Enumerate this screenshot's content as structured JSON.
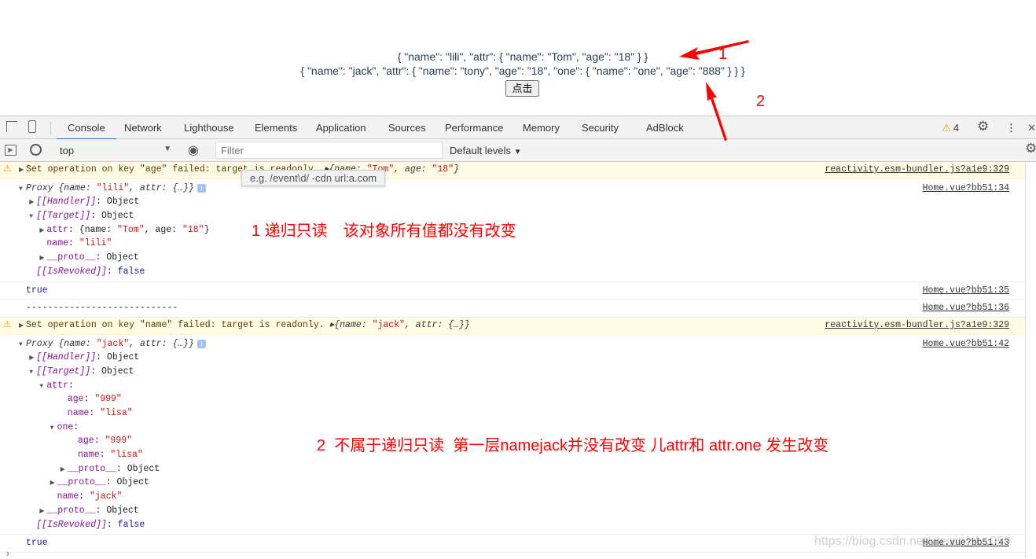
{
  "page": {
    "line1": "{ \"name\": \"lili\", \"attr\": { \"name\": \"Tom\", \"age\": \"18\" } }",
    "line2": "{ \"name\": \"jack\", \"attr\": { \"name\": \"tony\", \"age\": \"18\", \"one\": { \"name\": \"one\", \"age\": \"888\" } } }",
    "button": "点击"
  },
  "devtools": {
    "tabs": [
      "Console",
      "Network",
      "Lighthouse",
      "Elements",
      "Application",
      "Sources",
      "Performance",
      "Memory",
      "Security",
      "AdBlock"
    ],
    "warning_count": "4",
    "context": "top",
    "filter_placeholder": "Filter",
    "levels": "Default levels",
    "filter_tooltip": "e.g. /event\\d/ -cdn url:a.com"
  },
  "console": [
    {
      "type": "warn",
      "src": "reactivity.esm-bundler.js?a1e9:329",
      "lines": [
        [
          0,
          "c",
          [
            [
              "",
              "Set operation on key \"age\" failed: target is readonly. "
            ],
            [
              "it",
              "▸{name: "
            ],
            [
              "s",
              "\"Tom\""
            ],
            [
              "it",
              ", age: "
            ],
            [
              "s",
              "\"18\""
            ],
            [
              "it",
              "}"
            ]
          ]
        ]
      ]
    },
    {
      "type": "log",
      "src": "Home.vue?bb51:34",
      "lines": [
        [
          0,
          "o",
          [
            [
              "it",
              "Proxy {name: "
            ],
            [
              "s",
              "\"lili\""
            ],
            [
              "it",
              ", attr: {…}}"
            ]
          ]
        ],
        [
          1,
          "c",
          [
            [
              "k",
              "[[Handler]]"
            ],
            [
              "",
              ": Object"
            ]
          ]
        ],
        [
          1,
          "o",
          [
            [
              "k",
              "[[Target]]"
            ],
            [
              "",
              ": Object"
            ]
          ]
        ],
        [
          2,
          "c",
          [
            [
              "p",
              "attr"
            ],
            [
              "",
              ": {name: "
            ],
            [
              "s",
              "\"Tom\""
            ],
            [
              "",
              ", age: "
            ],
            [
              "s",
              "\"18\""
            ],
            [
              "",
              "}"
            ]
          ]
        ],
        [
          2,
          "n",
          [
            [
              "p",
              "name"
            ],
            [
              "",
              ": "
            ],
            [
              "s",
              "\"lili\""
            ]
          ]
        ],
        [
          2,
          "c",
          [
            [
              "p",
              "__proto__"
            ],
            [
              "",
              ": Object"
            ]
          ]
        ],
        [
          1,
          "n",
          [
            [
              "k",
              "[[IsRevoked]]"
            ],
            [
              "",
              ": "
            ],
            [
              "b",
              "false"
            ]
          ]
        ]
      ]
    },
    {
      "type": "log",
      "src": "Home.vue?bb51:35",
      "lines": [
        [
          0,
          "n",
          [
            [
              "b",
              "true"
            ]
          ]
        ]
      ]
    },
    {
      "type": "log",
      "src": "Home.vue?bb51:36",
      "lines": [
        [
          0,
          "n",
          [
            [
              "",
              "----------------------------"
            ]
          ]
        ]
      ]
    },
    {
      "type": "warn",
      "src": "reactivity.esm-bundler.js?a1e9:329",
      "lines": [
        [
          0,
          "c",
          [
            [
              "",
              "Set operation on key \"name\" failed: target is readonly. "
            ],
            [
              "it",
              "▸{name: "
            ],
            [
              "s",
              "\"jack\""
            ],
            [
              "it",
              ", attr: {…}}"
            ]
          ]
        ]
      ]
    },
    {
      "type": "log",
      "src": "Home.vue?bb51:42",
      "lines": [
        [
          0,
          "o",
          [
            [
              "it",
              "Proxy {name: "
            ],
            [
              "s",
              "\"jack\""
            ],
            [
              "it",
              ", attr: {…}}"
            ]
          ]
        ],
        [
          1,
          "c",
          [
            [
              "k",
              "[[Handler]]"
            ],
            [
              "",
              ": Object"
            ]
          ]
        ],
        [
          1,
          "o",
          [
            [
              "k",
              "[[Target]]"
            ],
            [
              "",
              ": Object"
            ]
          ]
        ],
        [
          2,
          "o",
          [
            [
              "p",
              "attr"
            ],
            [
              "",
              ":"
            ]
          ]
        ],
        [
          4,
          "n",
          [
            [
              "p",
              "age"
            ],
            [
              "",
              ": "
            ],
            [
              "s",
              "\"999\""
            ]
          ]
        ],
        [
          4,
          "n",
          [
            [
              "p",
              "name"
            ],
            [
              "",
              ": "
            ],
            [
              "s",
              "\"lisa\""
            ]
          ]
        ],
        [
          3,
          "o",
          [
            [
              "p",
              "one"
            ],
            [
              "",
              ":"
            ]
          ]
        ],
        [
          5,
          "n",
          [
            [
              "p",
              "age"
            ],
            [
              "",
              ": "
            ],
            [
              "s",
              "\"999\""
            ]
          ]
        ],
        [
          5,
          "n",
          [
            [
              "p",
              "name"
            ],
            [
              "",
              ": "
            ],
            [
              "s",
              "\"lisa\""
            ]
          ]
        ],
        [
          4,
          "c",
          [
            [
              "p",
              "__proto__"
            ],
            [
              "",
              ": Object"
            ]
          ]
        ],
        [
          3,
          "c",
          [
            [
              "p",
              "__proto__"
            ],
            [
              "",
              ": Object"
            ]
          ]
        ],
        [
          3,
          "n",
          [
            [
              "p",
              "name"
            ],
            [
              "",
              ": "
            ],
            [
              "s",
              "\"jack\""
            ]
          ]
        ],
        [
          2,
          "c",
          [
            [
              "p",
              "__proto__"
            ],
            [
              "",
              ": Object"
            ]
          ]
        ],
        [
          1,
          "n",
          [
            [
              "k",
              "[[IsRevoked]]"
            ],
            [
              "",
              ": "
            ],
            [
              "b",
              "false"
            ]
          ]
        ]
      ]
    },
    {
      "type": "log",
      "src": "Home.vue?bb51:43",
      "lines": [
        [
          0,
          "n",
          [
            [
              "b",
              "true"
            ]
          ]
        ]
      ]
    }
  ],
  "annotations": {
    "num1": "1",
    "num2": "2",
    "note1": "1 递归只读　该对象所有值都没有改变",
    "note2": "2  不属于递归只读  第一层namejack并没有改变 儿attr和 attr.one 发生改变"
  },
  "watermark": "https://blog.csdn.net/weixin_4...059",
  "colors": {
    "annotation": "#ff0000",
    "warning_bg": "#fffbe5",
    "active_tab": "#1a73e8"
  }
}
